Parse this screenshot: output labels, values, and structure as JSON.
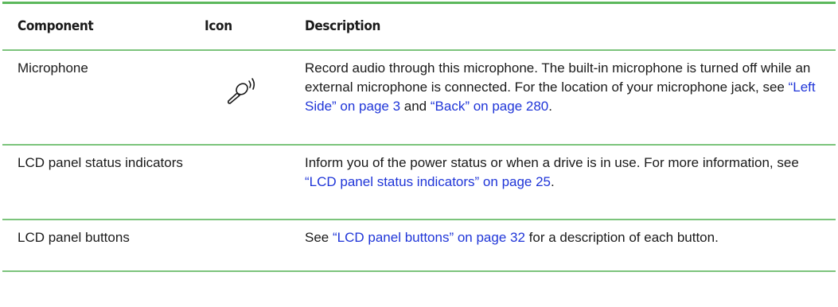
{
  "table": {
    "headers": {
      "component": "Component",
      "icon": "Icon",
      "description": "Description"
    },
    "rows": [
      {
        "component": "Microphone",
        "icon": "microphone-icon",
        "desc": {
          "t1": "Record audio through this microphone. The built-in microphone is turned off while an external microphone is connected. For the location of your microphone jack, see ",
          "l1": "“Left Side” on page 3",
          "t2": " and ",
          "l2": "“Back” on page 280",
          "t3": "."
        }
      },
      {
        "component": "LCD panel status indicators",
        "icon": "",
        "desc": {
          "t1": "Inform you of the power status or when a drive is in use. For more information, see ",
          "l1": "“LCD panel status indicators” on page 25",
          "t2": "."
        }
      },
      {
        "component": "LCD panel buttons",
        "icon": "",
        "desc": {
          "t1": "See ",
          "l1": "“LCD panel buttons” on page 32",
          "t2": " for a description of each button."
        }
      }
    ],
    "colors": {
      "rule": "#5cb85c",
      "link": "#1f35d8",
      "text": "#1a1a1a"
    }
  }
}
